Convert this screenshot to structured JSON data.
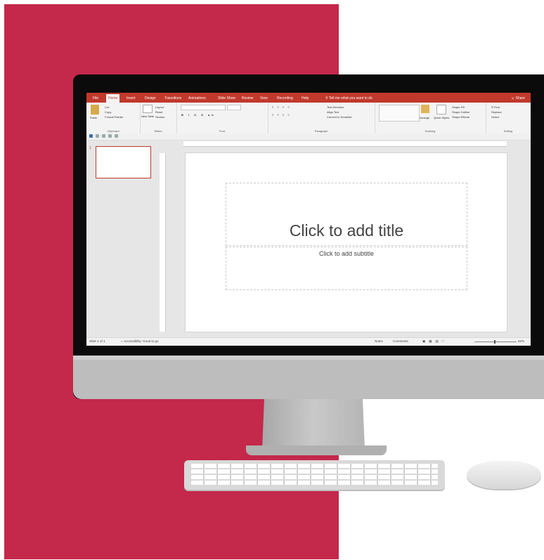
{
  "colors": {
    "accent": "#c4284a",
    "ribbon_red": "#c0392b",
    "monitor": "#0b0b0b",
    "aluminum": "#bdbdbd"
  },
  "tabs": [
    "File",
    "Home",
    "Insert",
    "Design",
    "Transitions",
    "Animations",
    "Slide Show",
    "Review",
    "View",
    "Recording",
    "Help"
  ],
  "active_tab": "Home",
  "tell_me": "Tell me what you want to do",
  "share": "Share",
  "ribbon": {
    "clipboard": {
      "label": "Clipboard",
      "paste": "Paste",
      "cut": "Cut",
      "copy": "Copy",
      "format_painter": "Format Painter"
    },
    "slides": {
      "label": "Slides",
      "new_slide": "New Slide",
      "layout": "Layout",
      "reset": "Reset",
      "section": "Section"
    },
    "font": {
      "label": "Font"
    },
    "paragraph": {
      "label": "Paragraph",
      "text_direction": "Text Direction",
      "align_text": "Align Text",
      "convert_smartart": "Convert to SmartArt"
    },
    "drawing": {
      "label": "Drawing",
      "arrange": "Arrange",
      "quick_styles": "Quick Styles",
      "shape_fill": "Shape Fill",
      "shape_outline": "Shape Outline",
      "shape_effects": "Shape Effects"
    },
    "editing": {
      "label": "Editing",
      "find": "Find",
      "replace": "Replace",
      "select": "Select"
    }
  },
  "thumbnail": {
    "number": "1"
  },
  "slide": {
    "title_placeholder": "Click to add title",
    "subtitle_placeholder": "Click to add subtitle"
  },
  "status": {
    "slide_count": "Slide 1 of 1",
    "accessibility": "Accessibility: Good to go",
    "notes": "Notes",
    "comments": "Comments",
    "zoom": "62%"
  }
}
